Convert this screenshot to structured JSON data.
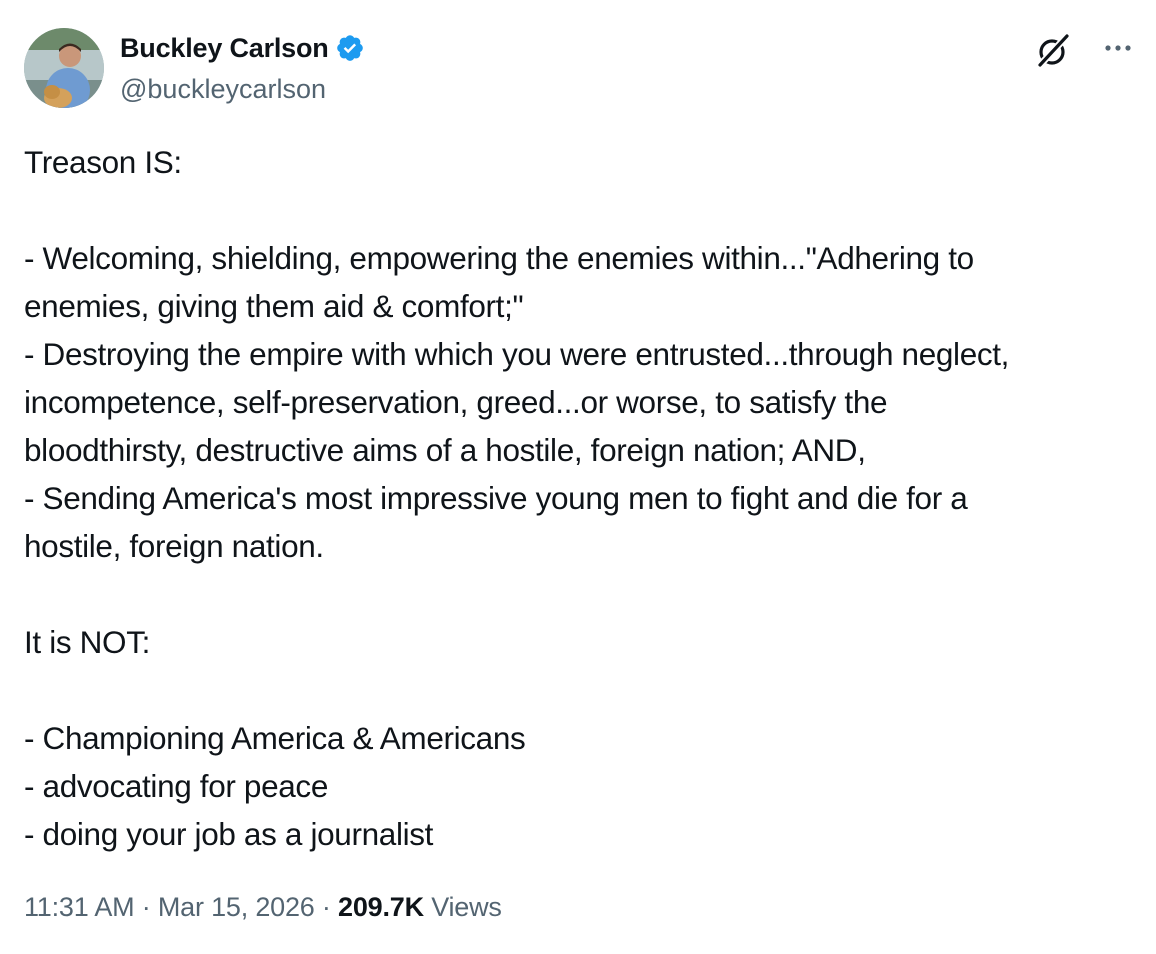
{
  "author": {
    "display_name": "Buckley Carlson",
    "handle": "@buckleycarlson",
    "verified": true
  },
  "icons": {
    "verified": "verified-badge-icon",
    "grok": "grok-icon",
    "more": "more-options-icon"
  },
  "colors": {
    "verified_blue": "#1d9bf0",
    "text_primary": "#0f1419",
    "text_secondary": "#536471"
  },
  "tweet": {
    "lines": [
      "Treason IS:",
      "",
      "- Welcoming, shielding, empowering the enemies within...\"Adhering to",
      "enemies, giving them aid & comfort;\"",
      "- Destroying the empire with which you were entrusted...through neglect,",
      "incompetence, self-preservation, greed...or worse, to satisfy the",
      "bloodthirsty, destructive aims of a hostile, foreign nation; AND,",
      "- Sending America's most impressive young men to fight and die for a",
      "hostile, foreign nation.",
      "",
      "It is NOT:",
      "",
      "- Championing America & Americans",
      "- advocating for peace",
      "- doing your job as a journalist"
    ]
  },
  "meta": {
    "time": "11:31 AM",
    "separator": " · ",
    "date": "Mar 15, 2026",
    "views_count": "209.7K",
    "views_label": "Views"
  }
}
